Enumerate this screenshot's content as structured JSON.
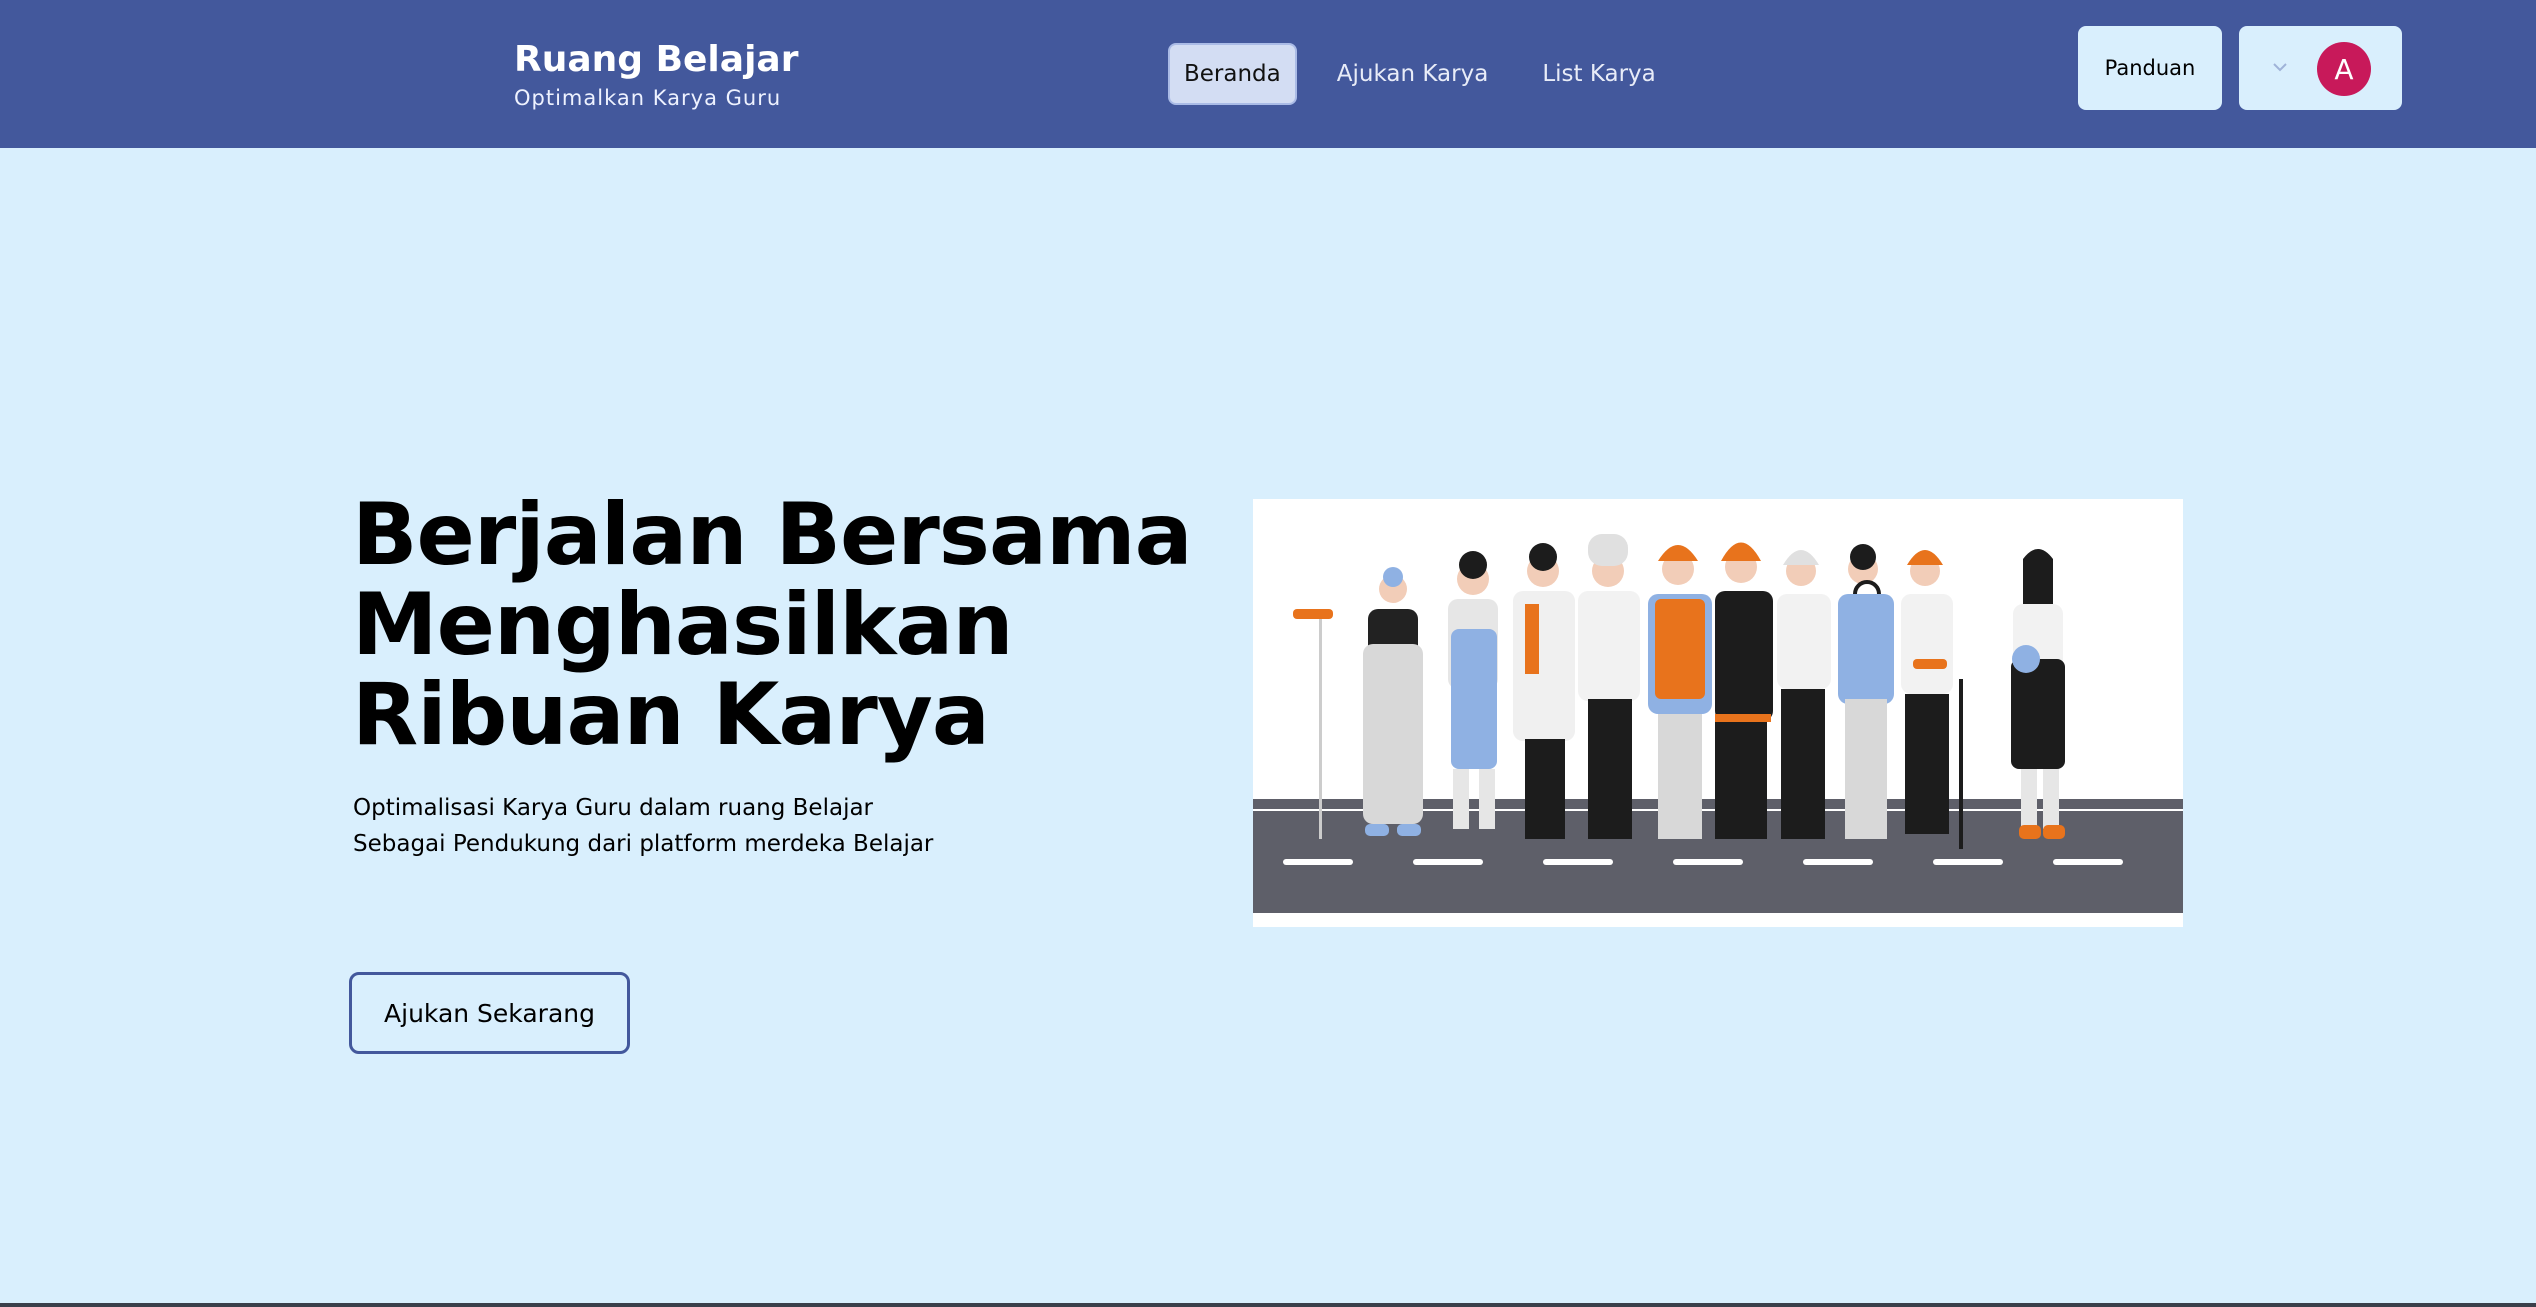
{
  "brand": {
    "title": "Ruang Belajar",
    "subtitle": "Optimalkan Karya Guru"
  },
  "nav": {
    "items": [
      {
        "label": "Beranda",
        "active": true
      },
      {
        "label": "Ajukan Karya",
        "active": false
      },
      {
        "label": "List Karya",
        "active": false
      }
    ]
  },
  "header": {
    "guide_label": "Panduan",
    "avatar_initial": "A",
    "menu_icon": "chevron-down-icon"
  },
  "hero": {
    "title_lines": [
      "Berjalan Bersama",
      "Menghasilkan",
      "Ribuan Karya"
    ],
    "description_lines": [
      "Optimalisasi Karya Guru dalam ruang Belajar",
      "Sebagai Pendukung dari platform merdeka Belajar"
    ],
    "cta_label": "Ajukan Sekarang",
    "illustration": "workers-group-illustration"
  },
  "colors": {
    "navbar": "#43589c",
    "background": "#d9effd",
    "avatar": "#c8195a",
    "accent_orange": "#e8731c",
    "accent_blue": "#8fb1e3"
  }
}
